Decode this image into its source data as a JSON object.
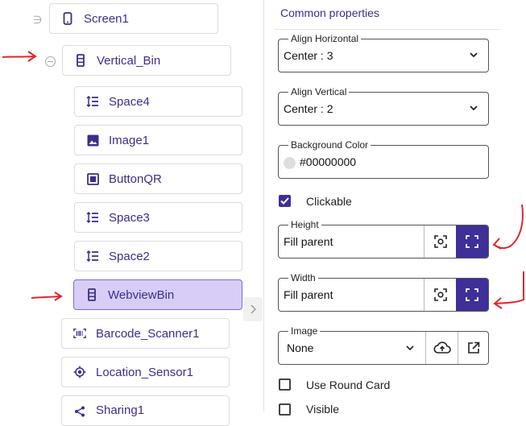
{
  "tree": {
    "nodes": [
      {
        "label": "Screen1",
        "icon": "phone-icon"
      },
      {
        "label": "Vertical_Bin",
        "icon": "vertical-arrangement-icon"
      },
      {
        "label": "Space4",
        "icon": "spacer-icon"
      },
      {
        "label": "Image1",
        "icon": "image-icon"
      },
      {
        "label": "ButtonQR",
        "icon": "button-icon"
      },
      {
        "label": "Space3",
        "icon": "spacer-icon"
      },
      {
        "label": "Space2",
        "icon": "spacer-icon"
      },
      {
        "label": "WebviewBin",
        "icon": "vertical-arrangement-icon"
      },
      {
        "label": "Barcode_Scanner1",
        "icon": "barcode-icon"
      },
      {
        "label": "Location_Sensor1",
        "icon": "location-icon"
      },
      {
        "label": "Sharing1",
        "icon": "share-icon"
      }
    ]
  },
  "properties": {
    "title": "Common properties",
    "align_horizontal": {
      "label": "Align Horizontal",
      "value": "Center : 3"
    },
    "align_vertical": {
      "label": "Align Vertical",
      "value": "Center : 2"
    },
    "background_color": {
      "label": "Background Color",
      "value": "#00000000"
    },
    "clickable": {
      "label": "Clickable",
      "checked": true
    },
    "height": {
      "label": "Height",
      "value": "Fill parent"
    },
    "width": {
      "label": "Width",
      "value": "Fill parent"
    },
    "image": {
      "label": "Image",
      "value": "None"
    },
    "use_round_card": {
      "label": "Use Round Card",
      "checked": false
    },
    "visible": {
      "label": "Visible",
      "checked": false
    }
  },
  "colors": {
    "accent": "#3e2f99",
    "selected_bg": "#d8cdf6",
    "annotation": "#e3262b"
  }
}
